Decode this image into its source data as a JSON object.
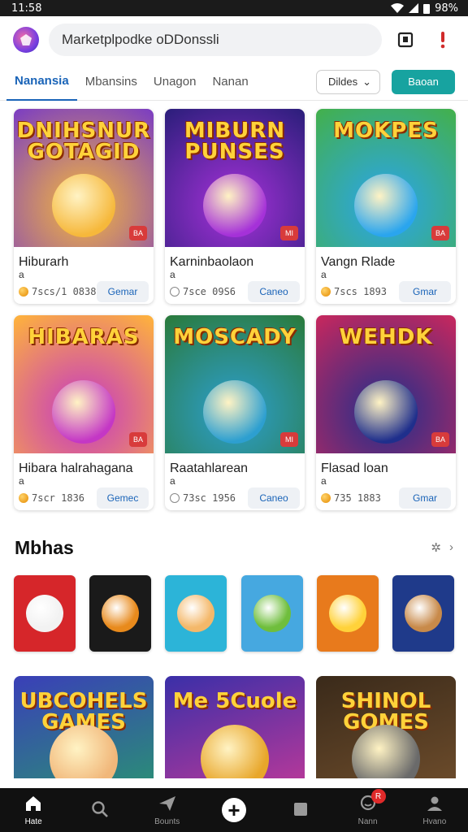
{
  "status": {
    "time": "11:58",
    "battery": "98%"
  },
  "header": {
    "search_value": "Marketplpodke oDDonssli"
  },
  "tabs": [
    "Nanansia",
    "Mbansins",
    "Unagon",
    "Nanan"
  ],
  "toolbar": {
    "dropdown_label": "Dildes",
    "primary_label": "Baoan"
  },
  "cards": [
    {
      "art": "DNIHSNUR GOTAGID",
      "title": "Hiburarh",
      "sub": "a",
      "price": "7scs/1 0838",
      "cta": "Gemar",
      "tag": "BA",
      "coin": "gold",
      "bg": [
        "#f6b83b",
        "#7a3cc4"
      ]
    },
    {
      "art": "MIBURN PUNSES",
      "title": "Karninbaolaon",
      "sub": "a",
      "price": "7sce 09S6",
      "cta": "Caneo",
      "tag": "MI",
      "coin": "empty",
      "bg": [
        "#a531d8",
        "#2a1e7a"
      ]
    },
    {
      "art": "MOKPES",
      "title": "Vangn Rlade",
      "sub": "a",
      "price": "7scs 1893",
      "cta": "Gmar",
      "tag": "BA",
      "coin": "gold",
      "bg": [
        "#2aa5ee",
        "#43b04a"
      ]
    },
    {
      "art": "HIBARAS",
      "title": "Hibara halrahagana",
      "sub": "a",
      "price": "7scr 1836",
      "cta": "Gemec",
      "tag": "BA",
      "coin": "gold",
      "bg": [
        "#c437c5",
        "#ffb43a"
      ]
    },
    {
      "art": "MOSCADY",
      "title": "Raatahlarean",
      "sub": "a",
      "price": "73sc 1956",
      "cta": "Caneo",
      "tag": "MI",
      "coin": "empty",
      "bg": [
        "#2d9fd0",
        "#2a7a3a"
      ]
    },
    {
      "art": "WEHDK",
      "title": "Flasad loan",
      "sub": "a",
      "price": "735 1883",
      "cta": "Gmar",
      "tag": "BA",
      "coin": "gold",
      "bg": [
        "#1f2f8c",
        "#c9275d"
      ]
    }
  ],
  "section": {
    "title": "Mbhas"
  },
  "minis": [
    {
      "bg": "#d6262a",
      "face": "#f2f2f2"
    },
    {
      "bg": "#1a1a1a",
      "face": "#e88a1c"
    },
    {
      "bg": "#2cb4d8",
      "face": "#f4b86a"
    },
    {
      "bg": "#46a8e0",
      "face": "#6fbe3c"
    },
    {
      "bg": "#e87a1c",
      "face": "#ffd23a"
    },
    {
      "bg": "#1f3a8a",
      "face": "#c88a4a"
    }
  ],
  "bigs": [
    {
      "art": "UBCOHELS GAMES",
      "bg": [
        "#3a3fb8",
        "#2b8a7a"
      ],
      "mascot": "#f1b77a"
    },
    {
      "art": "Me 5Cuole",
      "bg": [
        "#3a2fa8",
        "#b2389a"
      ],
      "mascot": "#e8a62a"
    },
    {
      "art": "SHINOL GOMES",
      "bg": [
        "#3a2a1a",
        "#6a4a2a"
      ],
      "mascot": "#6a6a6a"
    }
  ],
  "nav": [
    {
      "label": "Hate",
      "icon": "home-icon"
    },
    {
      "label": "",
      "icon": "search-icon"
    },
    {
      "label": "Bounts",
      "icon": "send-icon"
    },
    {
      "label": "",
      "icon": "add-icon"
    },
    {
      "label": "",
      "icon": "library-icon"
    },
    {
      "label": "Nann",
      "icon": "chat-icon",
      "badge": "R"
    },
    {
      "label": "Hvano",
      "icon": "profile-icon"
    }
  ]
}
